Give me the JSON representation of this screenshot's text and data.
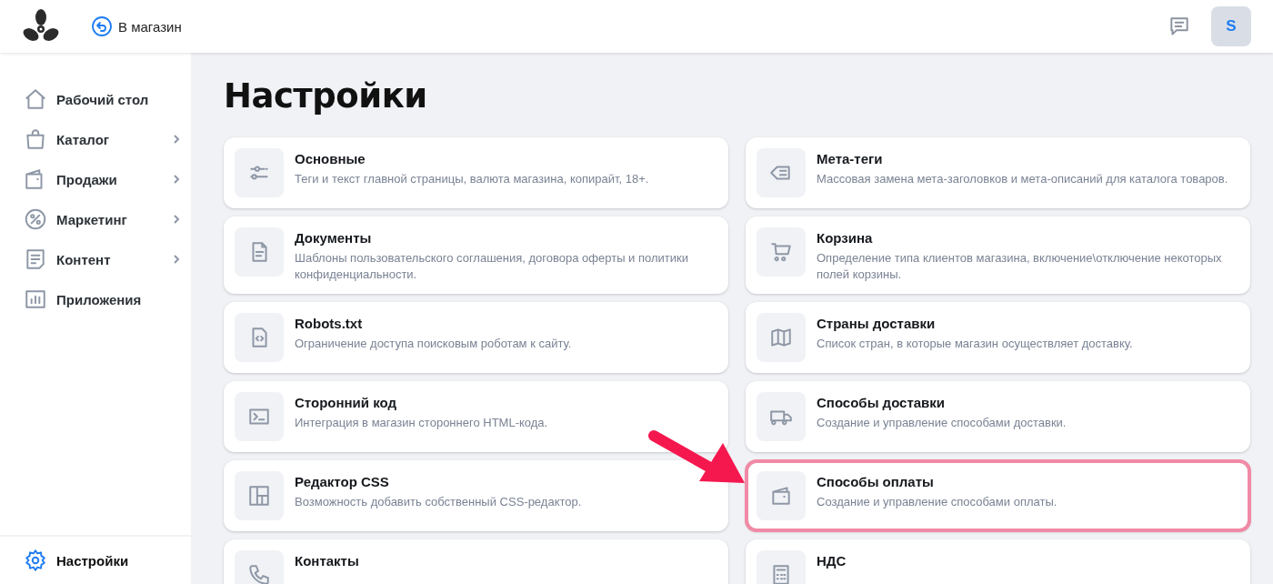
{
  "header": {
    "back_link": "В магазин",
    "avatar": "S"
  },
  "sidebar": {
    "items": [
      {
        "label": "Рабочий стол",
        "expandable": false,
        "selected": false
      },
      {
        "label": "Каталог",
        "expandable": true,
        "selected": false
      },
      {
        "label": "Продажи",
        "expandable": true,
        "selected": false
      },
      {
        "label": "Маркетинг",
        "expandable": true,
        "selected": false
      },
      {
        "label": "Контент",
        "expandable": true,
        "selected": false
      },
      {
        "label": "Приложения",
        "expandable": false,
        "selected": false
      }
    ],
    "footer_item": {
      "label": "Настройки",
      "selected": true
    }
  },
  "page_title": "Настройки",
  "columns": [
    [
      {
        "title": "Основные",
        "description": "Теги и текст главной страницы, валюта магазина, копирайт, 18+.",
        "highlighted": false
      },
      {
        "title": "Документы",
        "description": "Шаблоны пользовательского соглашения, договора оферты и политики конфиденциальности.",
        "highlighted": false
      },
      {
        "title": "Robots.txt",
        "description": "Ограничение доступа поисковым роботам к сайту.",
        "highlighted": false
      },
      {
        "title": "Сторонний код",
        "description": "Интеграция в магазин стороннего HTML-кода.",
        "highlighted": false
      },
      {
        "title": "Редактор CSS",
        "description": "Возможность добавить собственный CSS-редактор.",
        "highlighted": false
      },
      {
        "title": "Контакты",
        "highlighted": false
      }
    ],
    [
      {
        "title": "Мета-теги",
        "description": "Массовая замена мета-заголовков и мета-описаний для каталога товаров.",
        "highlighted": false
      },
      {
        "title": "Корзина",
        "description": "Определение типа клиентов магазина, включение\\отключение некоторых полей корзины.",
        "highlighted": false
      },
      {
        "title": "Страны доставки",
        "description": "Список стран, в которые магазин осуществляет доставку.",
        "highlighted": false
      },
      {
        "title": "Способы доставки",
        "description": "Создание и управление способами доставки.",
        "highlighted": false
      },
      {
        "title": "Способы оплаты",
        "description": "Создание и управление способами оплаты.",
        "highlighted": true
      },
      {
        "title": "НДС",
        "highlighted": false
      }
    ]
  ]
}
